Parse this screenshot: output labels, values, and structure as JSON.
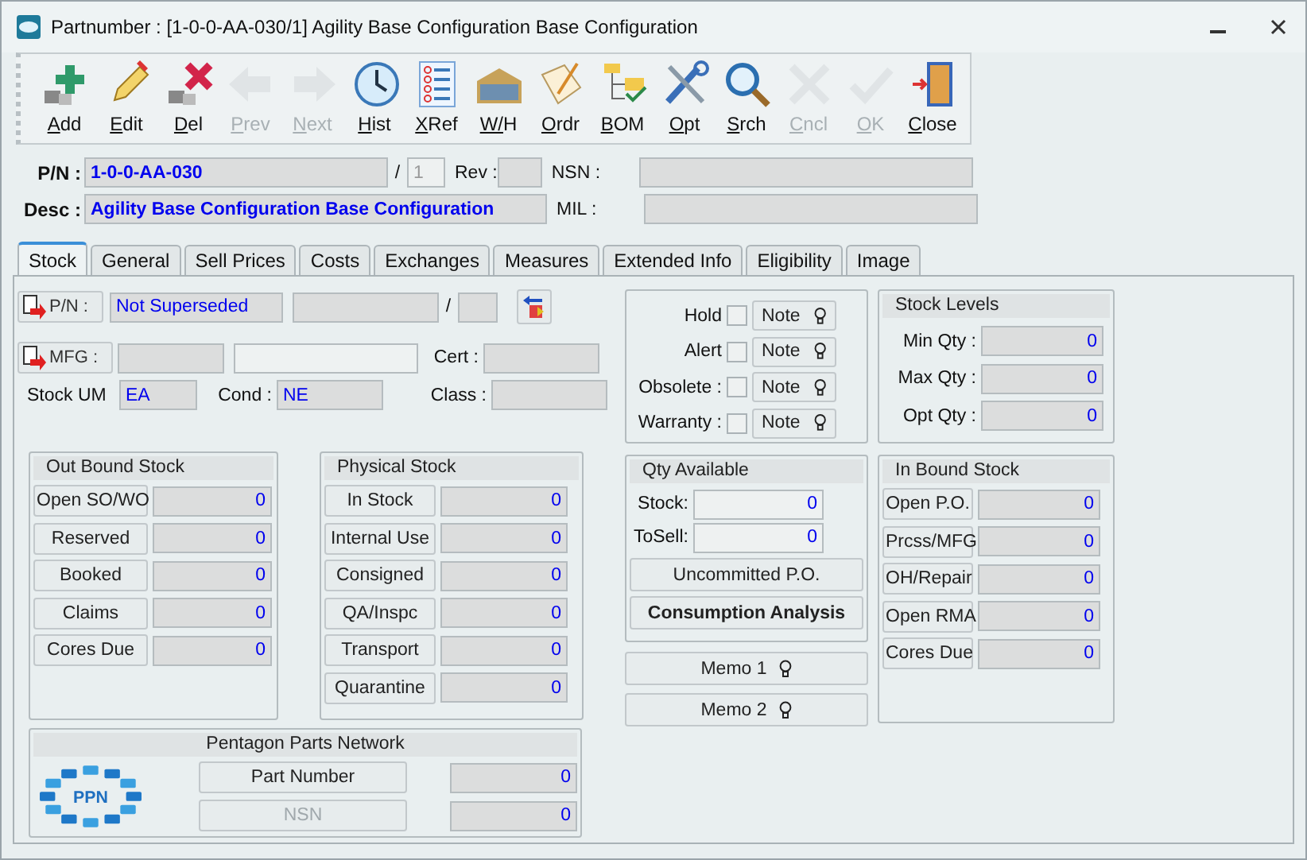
{
  "window": {
    "title": "Partnumber : [1-0-0-AA-030/1] Agility Base Configuration Base Configuration"
  },
  "toolbar": [
    {
      "label": "Add",
      "disabled": false
    },
    {
      "label": "Edit",
      "disabled": false
    },
    {
      "label": "Del",
      "disabled": false
    },
    {
      "label": "Prev",
      "disabled": true
    },
    {
      "label": "Next",
      "disabled": true
    },
    {
      "label": "Hist",
      "disabled": false
    },
    {
      "label": "XRef",
      "disabled": false
    },
    {
      "label": "W/H",
      "disabled": false
    },
    {
      "label": "Ordr",
      "disabled": false
    },
    {
      "label": "BOM",
      "disabled": false
    },
    {
      "label": "Opt",
      "disabled": false
    },
    {
      "label": "Srch",
      "disabled": false
    },
    {
      "label": "Cncl",
      "disabled": true
    },
    {
      "label": "OK",
      "disabled": true
    },
    {
      "label": "Close",
      "disabled": false
    }
  ],
  "header": {
    "pn_label": "P/N :",
    "pn": "1-0-0-AA-030",
    "slash": "/",
    "pn_rev": "1",
    "rev_label": "Rev :",
    "nsn_label": "NSN :",
    "desc_label": "Desc :",
    "desc": "Agility Base Configuration Base Configuration",
    "mil_label": "MIL :"
  },
  "tabs": [
    {
      "label": "Stock",
      "selected": true
    },
    {
      "label": "General",
      "selected": false
    },
    {
      "label": "Sell  Prices",
      "selected": false
    },
    {
      "label": "Costs",
      "selected": false
    },
    {
      "label": "Exchanges",
      "selected": false
    },
    {
      "label": "Measures",
      "selected": false
    },
    {
      "label": "Extended Info",
      "selected": false
    },
    {
      "label": "Eligibility",
      "selected": false
    },
    {
      "label": "Image",
      "selected": false
    }
  ],
  "stock": {
    "supersede_button": "P/N :",
    "supersede_value": "Not Superseded",
    "slash": "/",
    "mfg_button": "MFG :",
    "cert_label": "Cert :",
    "um_label": "Stock UM",
    "um": "EA",
    "cond_label": "Cond :",
    "cond": "NE",
    "class_label": "Class :",
    "flags": [
      {
        "label": "Hold",
        "checked": false,
        "note": "Note"
      },
      {
        "label": "Alert",
        "checked": false,
        "note": "Note"
      },
      {
        "label": "Obsolete :",
        "checked": false,
        "note": "Note"
      },
      {
        "label": "Warranty :",
        "checked": false,
        "note": "Note"
      }
    ],
    "stock_levels": {
      "title": "Stock Levels",
      "rows": [
        {
          "label": "Min Qty :",
          "value": "0"
        },
        {
          "label": "Max Qty :",
          "value": "0"
        },
        {
          "label": "Opt Qty :",
          "value": "0"
        }
      ]
    },
    "out_bound": {
      "title": "Out Bound Stock",
      "rows": [
        {
          "label": "Open SO/WO",
          "value": "0"
        },
        {
          "label": "Reserved",
          "value": "0"
        },
        {
          "label": "Booked",
          "value": "0"
        },
        {
          "label": "Claims",
          "value": "0"
        },
        {
          "label": "Cores Due",
          "value": "0"
        }
      ]
    },
    "physical": {
      "title": "Physical Stock",
      "rows": [
        {
          "label": "In Stock",
          "value": "0"
        },
        {
          "label": "Internal Use",
          "value": "0"
        },
        {
          "label": "Consigned",
          "value": "0"
        },
        {
          "label": "QA/Inspc",
          "value": "0"
        },
        {
          "label": "Transport",
          "value": "0"
        },
        {
          "label": "Quarantine",
          "value": "0"
        }
      ]
    },
    "qty_available": {
      "title": "Qty Available",
      "rows": [
        {
          "label": "Stock:",
          "value": "0"
        },
        {
          "label": "ToSell:",
          "value": "0"
        }
      ],
      "buttons": [
        {
          "label": "Uncommitted P.O.",
          "bold": false
        },
        {
          "label": "Consumption Analysis",
          "bold": true
        }
      ]
    },
    "memos": [
      "Memo 1",
      "Memo 2"
    ],
    "in_bound": {
      "title": "In Bound Stock",
      "rows": [
        {
          "label": "Open P.O.",
          "value": "0"
        },
        {
          "label": "Prcss/MFG",
          "value": "0"
        },
        {
          "label": "OH/Repair",
          "value": "0"
        },
        {
          "label": "Open RMA",
          "value": "0"
        },
        {
          "label": "Cores Due",
          "value": "0"
        }
      ]
    },
    "ppn": {
      "title": "Pentagon Parts Network",
      "logo_text": "PPN",
      "rows": [
        {
          "label": "Part Number",
          "value": "0",
          "disabled": false
        },
        {
          "label": "NSN",
          "value": "0",
          "disabled": true
        }
      ]
    }
  }
}
